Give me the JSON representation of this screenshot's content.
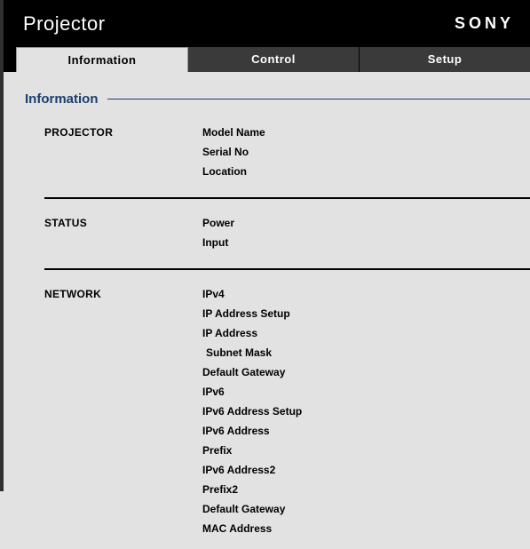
{
  "header": {
    "title": "Projector",
    "brand": "SONY"
  },
  "tabs": {
    "information": "Information",
    "control": "Control",
    "setup": "Setup"
  },
  "section_title": "Information",
  "groups": {
    "projector": {
      "label": "PROJECTOR",
      "items": {
        "model_name": "Model Name",
        "serial_no": "Serial No",
        "location": "Location"
      }
    },
    "status": {
      "label": "STATUS",
      "items": {
        "power": "Power",
        "input": "Input"
      }
    },
    "network": {
      "label": "NETWORK",
      "items": {
        "ipv4": "IPv4",
        "ip_address_setup": "IP Address Setup",
        "ip_address": "IP Address",
        "subnet_mask": "Subnet Mask",
        "default_gateway": "Default Gateway",
        "ipv6": "IPv6",
        "ipv6_address_setup": "IPv6 Address Setup",
        "ipv6_address": "IPv6 Address",
        "prefix": "Prefix",
        "ipv6_address2": "IPv6 Address2",
        "prefix2": "Prefix2",
        "default_gateway2": "Default Gateway",
        "mac_address": "MAC Address"
      }
    }
  }
}
